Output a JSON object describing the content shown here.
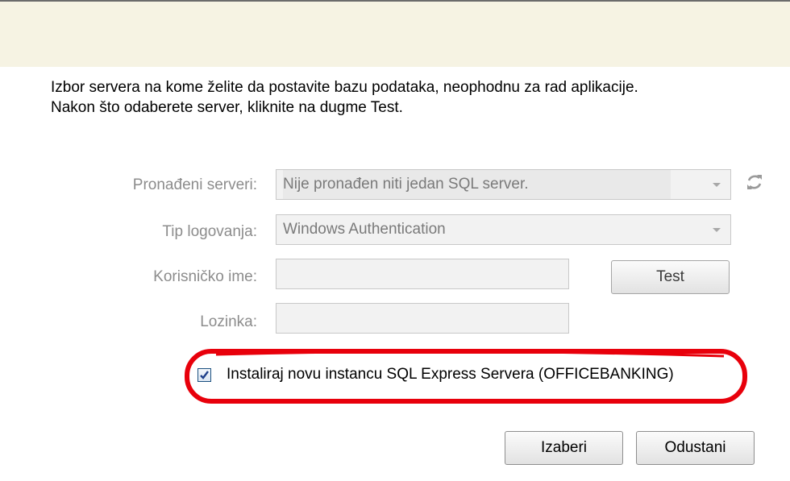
{
  "description": {
    "line1": "Izbor servera na kome želite da postavite bazu podataka, neophodnu za rad aplikacije.",
    "line2": "Nakon što odaberete server, kliknite na dugme Test."
  },
  "form": {
    "servers_label": "Pronađeni serveri:",
    "servers_value": "Nije pronađen niti jedan SQL server.",
    "login_type_label": "Tip logovanja:",
    "login_type_value": "Windows Authentication",
    "username_label": "Korisničko ime:",
    "username_value": "",
    "password_label": "Lozinka:",
    "password_value": "",
    "test_button": "Test"
  },
  "install_option": {
    "label": "Instaliraj novu instancu SQL Express Servera (OFFICEBANKING)",
    "checked": true
  },
  "footer": {
    "select_button": "Izaberi",
    "cancel_button": "Odustani"
  },
  "colors": {
    "banner": "#f6f3e3",
    "highlight": "#e8000b"
  },
  "icons": {
    "refresh": "refresh-icon",
    "dropdown": "chevron-down-icon",
    "check": "checkmark-icon"
  }
}
